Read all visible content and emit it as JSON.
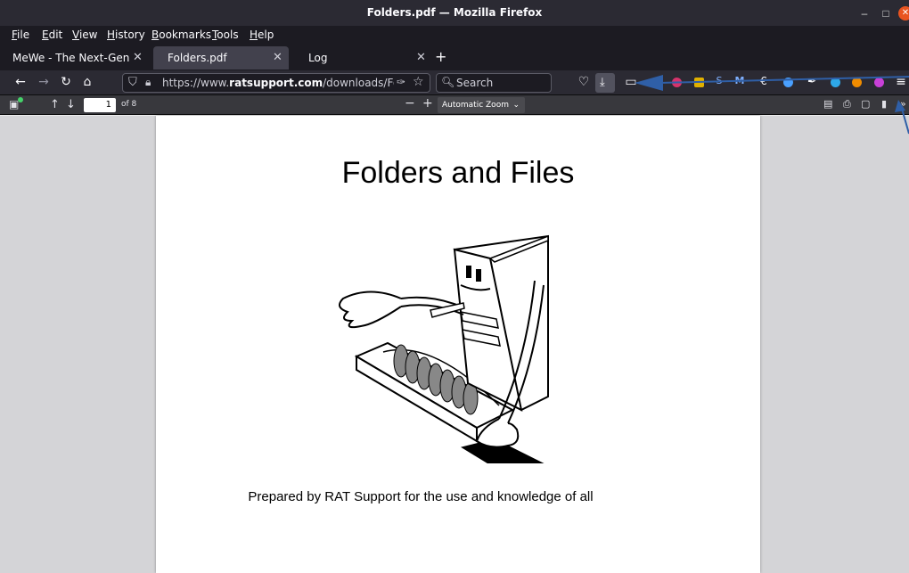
{
  "window": {
    "title": "Folders.pdf — Mozilla Firefox"
  },
  "menu": {
    "items": [
      "File",
      "Edit",
      "View",
      "History",
      "Bookmarks",
      "Tools",
      "Help"
    ]
  },
  "tabs": [
    {
      "label": "MeWe - The Next-Gen Social",
      "active": false
    },
    {
      "label": "Folders.pdf",
      "active": true
    },
    {
      "label": "Log",
      "active": false
    }
  ],
  "nav": {
    "url_prefix": "https://www.",
    "url_domain": "ratsupport.com",
    "url_path": "/downloads/Folders.pdf",
    "search_placeholder": "Search"
  },
  "pdf_toolbar": {
    "page_number": "1",
    "page_count": "of 8",
    "zoom": "Automatic Zoom"
  },
  "document": {
    "title": "Folders and Files",
    "caption": "Prepared by RAT Support for the use and knowledge of all"
  },
  "colors": {
    "annotation_arrow": "#2f5fa7",
    "download_active": "#52525e"
  }
}
